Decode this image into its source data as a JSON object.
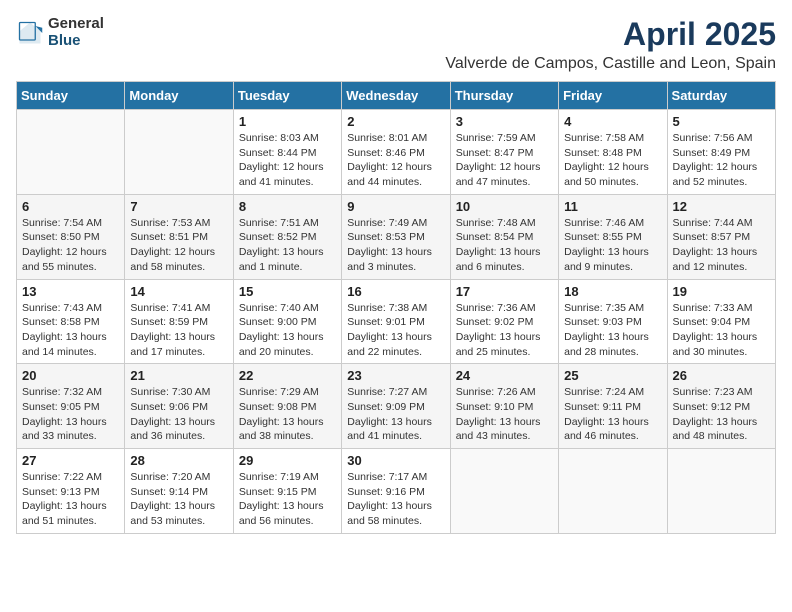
{
  "logo": {
    "general": "General",
    "blue": "Blue"
  },
  "title": "April 2025",
  "location": "Valverde de Campos, Castille and Leon, Spain",
  "days_header": [
    "Sunday",
    "Monday",
    "Tuesday",
    "Wednesday",
    "Thursday",
    "Friday",
    "Saturday"
  ],
  "weeks": [
    [
      {
        "day": "",
        "info": ""
      },
      {
        "day": "",
        "info": ""
      },
      {
        "day": "1",
        "info": "Sunrise: 8:03 AM\nSunset: 8:44 PM\nDaylight: 12 hours and 41 minutes."
      },
      {
        "day": "2",
        "info": "Sunrise: 8:01 AM\nSunset: 8:46 PM\nDaylight: 12 hours and 44 minutes."
      },
      {
        "day": "3",
        "info": "Sunrise: 7:59 AM\nSunset: 8:47 PM\nDaylight: 12 hours and 47 minutes."
      },
      {
        "day": "4",
        "info": "Sunrise: 7:58 AM\nSunset: 8:48 PM\nDaylight: 12 hours and 50 minutes."
      },
      {
        "day": "5",
        "info": "Sunrise: 7:56 AM\nSunset: 8:49 PM\nDaylight: 12 hours and 52 minutes."
      }
    ],
    [
      {
        "day": "6",
        "info": "Sunrise: 7:54 AM\nSunset: 8:50 PM\nDaylight: 12 hours and 55 minutes."
      },
      {
        "day": "7",
        "info": "Sunrise: 7:53 AM\nSunset: 8:51 PM\nDaylight: 12 hours and 58 minutes."
      },
      {
        "day": "8",
        "info": "Sunrise: 7:51 AM\nSunset: 8:52 PM\nDaylight: 13 hours and 1 minute."
      },
      {
        "day": "9",
        "info": "Sunrise: 7:49 AM\nSunset: 8:53 PM\nDaylight: 13 hours and 3 minutes."
      },
      {
        "day": "10",
        "info": "Sunrise: 7:48 AM\nSunset: 8:54 PM\nDaylight: 13 hours and 6 minutes."
      },
      {
        "day": "11",
        "info": "Sunrise: 7:46 AM\nSunset: 8:55 PM\nDaylight: 13 hours and 9 minutes."
      },
      {
        "day": "12",
        "info": "Sunrise: 7:44 AM\nSunset: 8:57 PM\nDaylight: 13 hours and 12 minutes."
      }
    ],
    [
      {
        "day": "13",
        "info": "Sunrise: 7:43 AM\nSunset: 8:58 PM\nDaylight: 13 hours and 14 minutes."
      },
      {
        "day": "14",
        "info": "Sunrise: 7:41 AM\nSunset: 8:59 PM\nDaylight: 13 hours and 17 minutes."
      },
      {
        "day": "15",
        "info": "Sunrise: 7:40 AM\nSunset: 9:00 PM\nDaylight: 13 hours and 20 minutes."
      },
      {
        "day": "16",
        "info": "Sunrise: 7:38 AM\nSunset: 9:01 PM\nDaylight: 13 hours and 22 minutes."
      },
      {
        "day": "17",
        "info": "Sunrise: 7:36 AM\nSunset: 9:02 PM\nDaylight: 13 hours and 25 minutes."
      },
      {
        "day": "18",
        "info": "Sunrise: 7:35 AM\nSunset: 9:03 PM\nDaylight: 13 hours and 28 minutes."
      },
      {
        "day": "19",
        "info": "Sunrise: 7:33 AM\nSunset: 9:04 PM\nDaylight: 13 hours and 30 minutes."
      }
    ],
    [
      {
        "day": "20",
        "info": "Sunrise: 7:32 AM\nSunset: 9:05 PM\nDaylight: 13 hours and 33 minutes."
      },
      {
        "day": "21",
        "info": "Sunrise: 7:30 AM\nSunset: 9:06 PM\nDaylight: 13 hours and 36 minutes."
      },
      {
        "day": "22",
        "info": "Sunrise: 7:29 AM\nSunset: 9:08 PM\nDaylight: 13 hours and 38 minutes."
      },
      {
        "day": "23",
        "info": "Sunrise: 7:27 AM\nSunset: 9:09 PM\nDaylight: 13 hours and 41 minutes."
      },
      {
        "day": "24",
        "info": "Sunrise: 7:26 AM\nSunset: 9:10 PM\nDaylight: 13 hours and 43 minutes."
      },
      {
        "day": "25",
        "info": "Sunrise: 7:24 AM\nSunset: 9:11 PM\nDaylight: 13 hours and 46 minutes."
      },
      {
        "day": "26",
        "info": "Sunrise: 7:23 AM\nSunset: 9:12 PM\nDaylight: 13 hours and 48 minutes."
      }
    ],
    [
      {
        "day": "27",
        "info": "Sunrise: 7:22 AM\nSunset: 9:13 PM\nDaylight: 13 hours and 51 minutes."
      },
      {
        "day": "28",
        "info": "Sunrise: 7:20 AM\nSunset: 9:14 PM\nDaylight: 13 hours and 53 minutes."
      },
      {
        "day": "29",
        "info": "Sunrise: 7:19 AM\nSunset: 9:15 PM\nDaylight: 13 hours and 56 minutes."
      },
      {
        "day": "30",
        "info": "Sunrise: 7:17 AM\nSunset: 9:16 PM\nDaylight: 13 hours and 58 minutes."
      },
      {
        "day": "",
        "info": ""
      },
      {
        "day": "",
        "info": ""
      },
      {
        "day": "",
        "info": ""
      }
    ]
  ]
}
